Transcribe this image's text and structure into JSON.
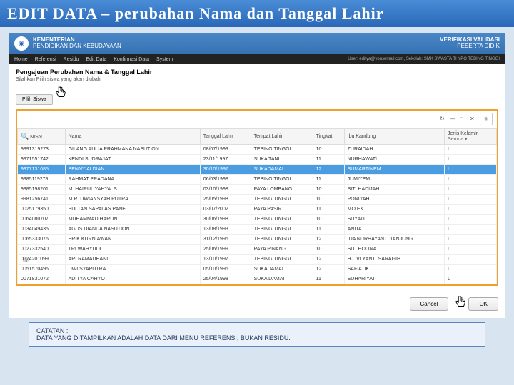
{
  "slide_title": "EDIT DATA – perubahan Nama dan Tanggal Lahir",
  "ministry": {
    "line1": "KEMENTERIAN",
    "line2": "PENDIDIKAN DAN KEBUDAYAAN"
  },
  "badge": {
    "line1": "VERIFIKASI VALIDASI",
    "line2": "PESERTA DIDIK"
  },
  "menu": [
    "Home",
    "Referensi",
    "Residu",
    "Edit Data",
    "Konfirmasi Data",
    "System"
  ],
  "user_info": "User: editya@yonsemail.com, Sekolah: SMK SWASTA TI YPO TEBING TINGGI",
  "page": {
    "title": "Pengajuan Perubahan Nama & Tanggal Lahir",
    "subtitle": "Silahkan Pilih siswa yang akan diubah"
  },
  "btn_pilih": "Pilih Siswa",
  "columns": [
    "NISN",
    "Nama",
    "Tanggal Lahir",
    "Tempat Lahir",
    "Tingkat",
    "Ibu Kandung",
    "Jenis Kelamin"
  ],
  "jk_filter": "Semua ▾",
  "rows": [
    {
      "nisn": "9991319273",
      "nama": "GILANG AULIA PRAHMANA NASUTION",
      "tgl": "08/07/1999",
      "tempat": "TEBING TINGGI",
      "tingkat": "10",
      "ibu": "ZURAIDAH",
      "jk": "L",
      "sel": false
    },
    {
      "nisn": "9971551742",
      "nama": "KENDI SUDRAJAT",
      "tgl": "23/11/1997",
      "tempat": "SUKA TANI",
      "tingkat": "11",
      "ibu": "NURHAWATI",
      "jk": "L",
      "sel": false
    },
    {
      "nisn": "9977131085",
      "nama": "BENNY ALDIAN",
      "tgl": "30/10/1997",
      "tempat": "SUKADAMAI",
      "tingkat": "12",
      "ibu": "SUMARTINEM",
      "jk": "L",
      "sel": true
    },
    {
      "nisn": "9985119278",
      "nama": "RAHMAT PRADANA",
      "tgl": "06/03/1998",
      "tempat": "TEBING TINGGI",
      "tingkat": "11",
      "ibu": "JUMIYEM",
      "jk": "L",
      "sel": false
    },
    {
      "nisn": "9985198201",
      "nama": "M. HAIRUL YAHYA. S",
      "tgl": "03/10/1998",
      "tempat": "PAYA LOMBANG",
      "tingkat": "10",
      "ibu": "SITI HADIJAH",
      "jk": "L",
      "sel": false
    },
    {
      "nisn": "9981256741",
      "nama": "M.R. DWIANSYAH PUTRA",
      "tgl": "25/05/1998",
      "tempat": "TEBING TINGGI",
      "tingkat": "10",
      "ibu": "PONIYAH",
      "jk": "L",
      "sel": false
    },
    {
      "nisn": "0025179350",
      "nama": "SULTAN SAPALAS PANE",
      "tgl": "03/07/2002",
      "tempat": "PAYA PASIR",
      "tingkat": "11",
      "ibu": "MO EK",
      "jk": "L",
      "sel": false
    },
    {
      "nisn": "0064080707",
      "nama": "MUHAMMAD HARUN",
      "tgl": "30/06/1998",
      "tempat": "TEBING TINGGI",
      "tingkat": "10",
      "ibu": "SUYATI",
      "jk": "L",
      "sel": false
    },
    {
      "nisn": "0034049435",
      "nama": "AGUS DIANDA NASUTION",
      "tgl": "13/08/1993",
      "tempat": "TEBING TINGGI",
      "tingkat": "11",
      "ibu": "ANITA",
      "jk": "L",
      "sel": false
    },
    {
      "nisn": "0065333076",
      "nama": "ERIK KURNIAWAN",
      "tgl": "31/12/1996",
      "tempat": "TEBING TINGGI",
      "tingkat": "12",
      "ibu": "IDA NURHAYANTI TANJUNG",
      "jk": "L",
      "sel": false
    },
    {
      "nisn": "0027332540",
      "nama": "TRI WAHYUDI",
      "tgl": "25/06/1999",
      "tempat": "PAYA PINANG",
      "tingkat": "10",
      "ibu": "SITI HOLINA",
      "jk": "L",
      "sel": false
    },
    {
      "nisn": "0074201099",
      "nama": "ARI RAMADHANI",
      "tgl": "13/10/1997",
      "tempat": "TEBING TINGGI",
      "tingkat": "12",
      "ibu": "HJ. VI YANTI SARAGIH",
      "jk": "L",
      "sel": false
    },
    {
      "nisn": "0051570496",
      "nama": "DWI SYAPUTRA",
      "tgl": "05/10/1996",
      "tempat": "SUKADAMAI",
      "tingkat": "12",
      "ibu": "SAFIATIK",
      "jk": "L",
      "sel": false
    },
    {
      "nisn": "0071831072",
      "nama": "ADITYA CAHYO",
      "tgl": "25/04/1998",
      "tempat": "SUKA DAMAI",
      "tingkat": "11",
      "ibu": "SUHARIYATI",
      "jk": "L",
      "sel": false
    }
  ],
  "buttons": {
    "cancel": "Cancel",
    "ok": "OK"
  },
  "note": {
    "title": "CATATAN :",
    "body": "DATA YANG DITAMPILKAN ADALAH DATA DARI MENU REFERENSI, BUKAN RESIDU."
  }
}
